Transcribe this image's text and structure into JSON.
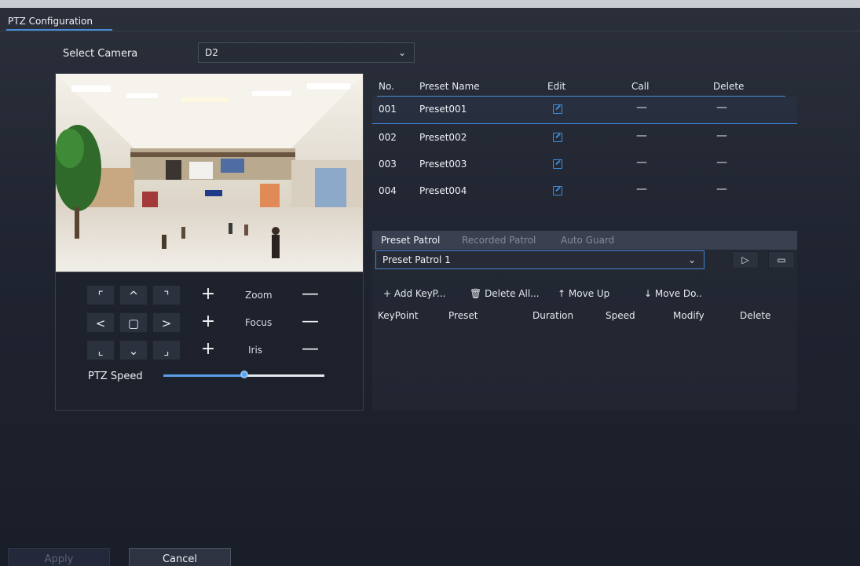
{
  "window": {
    "title": "PTZ Configuration"
  },
  "camera": {
    "label": "Select Camera",
    "value": "D2"
  },
  "ptz": {
    "zoom_label": "Zoom",
    "focus_label": "Focus",
    "iris_label": "Iris",
    "speed_label": "PTZ Speed",
    "speed_fraction": 0.5
  },
  "presets": {
    "headers": {
      "no": "No.",
      "name": "Preset Name",
      "edit": "Edit",
      "call": "Call",
      "delete": "Delete"
    },
    "rows": [
      {
        "no": "001",
        "name": "Preset001",
        "call": "—",
        "delete": "—"
      },
      {
        "no": "002",
        "name": "Preset002",
        "call": "—",
        "delete": "—"
      },
      {
        "no": "003",
        "name": "Preset003",
        "call": "—",
        "delete": "—"
      },
      {
        "no": "004",
        "name": "Preset004",
        "call": "—",
        "delete": "—"
      }
    ]
  },
  "patrol": {
    "tabs": [
      "Preset Patrol",
      "Recorded Patrol",
      "Auto Guard"
    ],
    "selected": "Preset Patrol 1",
    "actions": {
      "add": "+ Add KeyP...",
      "delete_all": "Delete All...",
      "move_up": "Move Up",
      "move_down": "Move Do.."
    },
    "columns": [
      "KeyPoint",
      "Preset",
      "Duration",
      "Speed",
      "Modify",
      "Delete"
    ]
  },
  "footer": {
    "apply": "Apply",
    "cancel": "Cancel"
  },
  "colors": {
    "accent": "#4a8bd8",
    "panel": "#1f2430"
  }
}
